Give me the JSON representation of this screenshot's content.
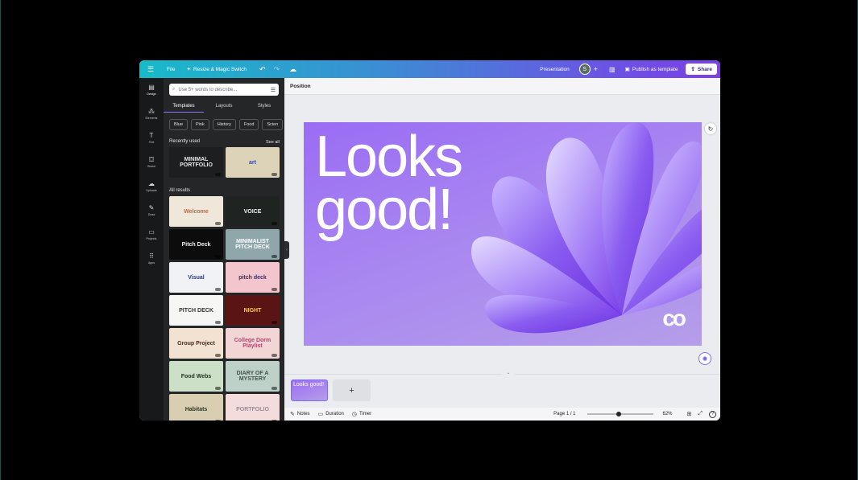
{
  "topbar": {
    "file_label": "File",
    "resize_label": "Resize & Magic Switch",
    "doc_type": "Presentation",
    "avatar_letter": "S",
    "publish_label": "Publish as template",
    "share_label": "Share"
  },
  "rail": {
    "items": [
      {
        "label": "Design",
        "icon": "design-icon"
      },
      {
        "label": "Elements",
        "icon": "elements-icon"
      },
      {
        "label": "Text",
        "icon": "text-icon"
      },
      {
        "label": "Brand",
        "icon": "brand-icon"
      },
      {
        "label": "Uploads",
        "icon": "uploads-icon"
      },
      {
        "label": "Draw",
        "icon": "draw-icon"
      },
      {
        "label": "Projects",
        "icon": "projects-icon"
      },
      {
        "label": "Apps",
        "icon": "apps-icon"
      }
    ]
  },
  "panel": {
    "search_placeholder": "Use 5+ words to describe...",
    "tabs": [
      "Templates",
      "Layouts",
      "Styles"
    ],
    "chips": [
      "Blue",
      "Pink",
      "History",
      "Food",
      "Scien"
    ],
    "recent_title": "Recently used",
    "see_all": "See all",
    "recent": [
      {
        "text": "MINIMAL PORTFOLIO",
        "bg": "#1d1e20",
        "fg": "#e6e6e6"
      },
      {
        "text": "art",
        "bg": "#dcd3b8",
        "fg": "#2a4fb0"
      }
    ],
    "all_title": "All results",
    "results": [
      {
        "text": "Welcome",
        "bg": "#efe7d9",
        "fg": "#c7663f"
      },
      {
        "text": "VOICE",
        "bg": "#1f2321",
        "fg": "#f1f1f1"
      },
      {
        "text": "Pitch Deck",
        "bg": "#0c0c0c",
        "fg": "#f2f2f2"
      },
      {
        "text": "MINIMALIST PITCH DECK",
        "bg": "#8fa7ab",
        "fg": "#ffffff"
      },
      {
        "text": "Visual",
        "bg": "#f1f2f6",
        "fg": "#2b3a7a"
      },
      {
        "text": "pitch deck",
        "bg": "#f2c6cc",
        "fg": "#3b2a6e"
      },
      {
        "text": "PITCH DECK",
        "bg": "#f6f6f4",
        "fg": "#333333"
      },
      {
        "text": "NIGHT",
        "bg": "#5b1414",
        "fg": "#ffcc55"
      },
      {
        "text": "Group Project",
        "bg": "#f2e2d2",
        "fg": "#4a2a1a"
      },
      {
        "text": "College Dorm Playlist",
        "bg": "#f2d6d6",
        "fg": "#b0476e"
      },
      {
        "text": "Food Webs",
        "bg": "#cbe0c6",
        "fg": "#21352a"
      },
      {
        "text": "DIARY OF A MYSTERY",
        "bg": "#bdd1c8",
        "fg": "#44524d"
      },
      {
        "text": "Habitats",
        "bg": "#d9cdb2",
        "fg": "#2d3a2a"
      },
      {
        "text": "PORTFOLIO",
        "bg": "#f4dcdc",
        "fg": "#9a8a9a"
      }
    ]
  },
  "canvas": {
    "position_label": "Position",
    "slide_title_line1": "Looks",
    "slide_title_line2": "good!",
    "logo_text": "co"
  },
  "pages": {
    "thumb_text": "Looks good!",
    "add_label": "+"
  },
  "bottombar": {
    "notes": "Notes",
    "duration": "Duration",
    "timer": "Timer",
    "page": "Page 1 / 1",
    "zoom_value": "62%",
    "zoom_fraction": 0.48,
    "help": "?"
  }
}
